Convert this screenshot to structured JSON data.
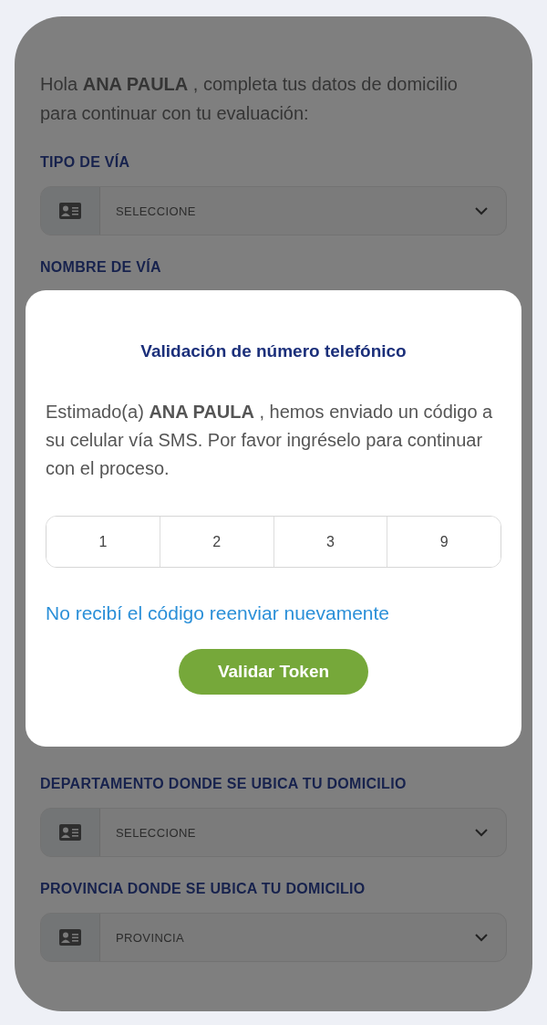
{
  "greeting": "Hola **ANA PAULA** , completa tus datos de domicilio para continuar con tu evaluación:",
  "fields_top": [
    {
      "label": "TIPO DE VÍA",
      "value": "SELECCIONE"
    },
    {
      "label": "NOMBRE DE VÍA"
    }
  ],
  "fields_bottom": [
    {
      "label": "DEPARTAMENTO DONDE SE UBICA TU DOMICILIO",
      "value": "SELECCIONE"
    },
    {
      "label": "PROVINCIA DONDE SE UBICA TU DOMICILIO",
      "value": "PROVINCIA"
    }
  ],
  "modal": {
    "title": "Validación de número telefónico",
    "message": "Estimado(a) **ANA PAULA** , hemos enviado un código a su celular vía SMS. Por favor ingréselo para continuar con el proceso.",
    "code": [
      "1",
      "2",
      "3",
      "9"
    ],
    "resend_link": "No recibí el código reenviar nuevamente",
    "button": "Validar Token"
  }
}
